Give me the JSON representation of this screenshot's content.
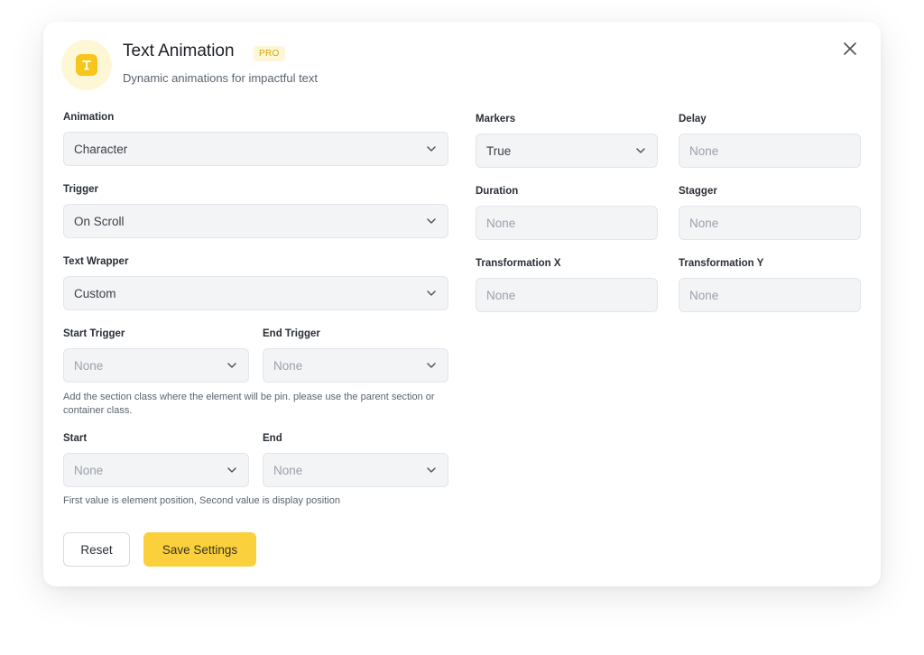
{
  "header": {
    "title": "Text Animation",
    "badge": "PRO",
    "subtitle": "Dynamic animations for impactful text",
    "logo_icon": "text-letter-icon",
    "accent_color": "#f8c51c"
  },
  "fields": {
    "animation": {
      "label": "Animation",
      "value": "Character"
    },
    "trigger": {
      "label": "Trigger",
      "value": "On Scroll"
    },
    "text_wrapper": {
      "label": "Text Wrapper",
      "value": "Custom"
    },
    "start_trigger": {
      "label": "Start Trigger",
      "placeholder": "None"
    },
    "end_trigger": {
      "label": "End Trigger",
      "placeholder": "None"
    },
    "trigger_hint": "Add the section class where the element will be pin. please use the parent section or container class.",
    "start": {
      "label": "Start",
      "placeholder": "None"
    },
    "end": {
      "label": "End",
      "placeholder": "None"
    },
    "position_hint": "First value is element position, Second value is display position",
    "markers": {
      "label": "Markers",
      "value": "True"
    },
    "delay": {
      "label": "Delay",
      "placeholder": "None"
    },
    "duration": {
      "label": "Duration",
      "placeholder": "None"
    },
    "stagger": {
      "label": "Stagger",
      "placeholder": "None"
    },
    "transformation_x": {
      "label": "Transformation X",
      "placeholder": "None"
    },
    "transformation_y": {
      "label": "Transformation Y",
      "placeholder": "None"
    }
  },
  "actions": {
    "reset_label": "Reset",
    "save_label": "Save Settings",
    "save_color": "#fbd03d"
  }
}
